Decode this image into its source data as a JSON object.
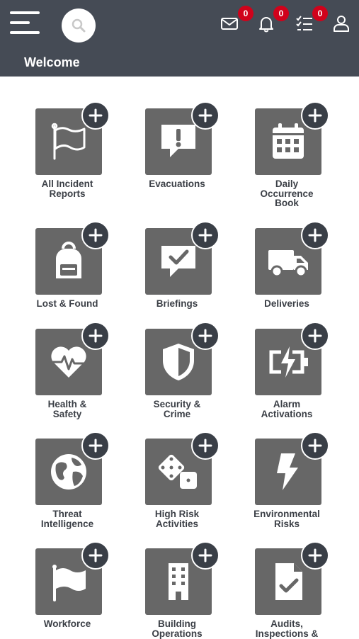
{
  "header": {
    "title": "Welcome",
    "badges": {
      "messages": "0",
      "notifications": "0",
      "tasks": "0"
    },
    "background": "#454b55"
  },
  "colors": {
    "tile": "#676767",
    "plus": "#3a3f47",
    "badge": "#d0021b",
    "label": "#3b3f46"
  },
  "tiles": [
    {
      "label": "All Incident\nReports",
      "icon": "flag-icon"
    },
    {
      "label": "Evacuations",
      "icon": "exclamation-bubble-icon"
    },
    {
      "label": "Daily\nOccurrence\nBook",
      "icon": "calendar-icon"
    },
    {
      "label": "Lost & Found",
      "icon": "backpack-icon"
    },
    {
      "label": "Briefings",
      "icon": "check-bubble-icon"
    },
    {
      "label": "Deliveries",
      "icon": "truck-icon"
    },
    {
      "label": "Health &\nSafety",
      "icon": "heartbeat-icon"
    },
    {
      "label": "Security &\nCrime",
      "icon": "shield-icon"
    },
    {
      "label": "Alarm\nActivations",
      "icon": "battery-bolt-icon"
    },
    {
      "label": "Threat\nIntelligence",
      "icon": "globe-icon"
    },
    {
      "label": "High Risk\nActivities",
      "icon": "dice-icon"
    },
    {
      "label": "Environmental\nRisks",
      "icon": "lightning-icon"
    },
    {
      "label": "Workforce",
      "icon": "waving-flag-icon"
    },
    {
      "label": "Building\nOperations",
      "icon": "building-icon"
    },
    {
      "label": "Audits,\nInspections &",
      "icon": "document-check-icon"
    }
  ]
}
